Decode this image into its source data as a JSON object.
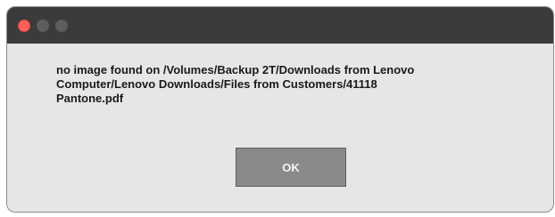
{
  "dialog": {
    "message": "no image found on /Volumes/Backup 2T/Downloads from Lenovo\nComputer/Lenovo Downloads/Files from Customers/41118\nPantone.pdf",
    "ok_label": "OK"
  },
  "titlebar": {
    "buttons": [
      "close",
      "minimize",
      "zoom"
    ]
  },
  "colors": {
    "titlebar": "#3b3b3b",
    "close": "#fe5f57",
    "inactive_light": "#5d5d5d",
    "dialog_bg": "#e6e6e6",
    "button_bg": "#8a8a8a"
  }
}
